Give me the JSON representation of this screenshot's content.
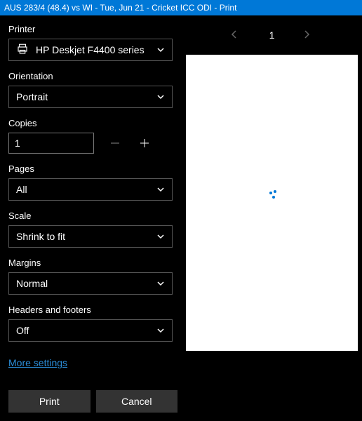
{
  "titlebar": "AUS 283/4 (48.4) vs WI - Tue, Jun 21 - Cricket ICC ODI - Print",
  "printer": {
    "label": "Printer",
    "value": "HP Deskjet F4400 series"
  },
  "orientation": {
    "label": "Orientation",
    "value": "Portrait"
  },
  "copies": {
    "label": "Copies",
    "value": "1"
  },
  "pages": {
    "label": "Pages",
    "value": "All"
  },
  "scale": {
    "label": "Scale",
    "value": "Shrink to fit"
  },
  "margins": {
    "label": "Margins",
    "value": "Normal"
  },
  "headers": {
    "label": "Headers and footers",
    "value": "Off"
  },
  "more_settings": "More settings",
  "buttons": {
    "print": "Print",
    "cancel": "Cancel"
  },
  "preview": {
    "page_number": "1"
  }
}
